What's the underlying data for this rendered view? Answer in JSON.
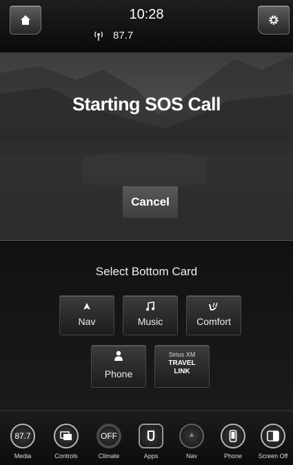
{
  "status_bar": {
    "time": "10:28",
    "radio_frequency": "87.7"
  },
  "sos": {
    "title": "Starting SOS Call",
    "cancel_label": "Cancel"
  },
  "card_selector": {
    "title": "Select Bottom Card",
    "cards": [
      {
        "label": "Nav",
        "icon": "nav-arrow-icon"
      },
      {
        "label": "Music",
        "icon": "music-note-icon"
      },
      {
        "label": "Comfort",
        "icon": "seat-heat-icon"
      },
      {
        "label": "Phone",
        "icon": "person-icon"
      }
    ],
    "siriusxm": {
      "brand": "Sirius XM",
      "line1": "TRAVEL",
      "line2": "LINK"
    }
  },
  "dock": {
    "items": [
      {
        "label": "Media",
        "value": "87.7"
      },
      {
        "label": "Controls",
        "icon": "controls-icon"
      },
      {
        "label": "Climate",
        "value": "OFF"
      },
      {
        "label": "Apps",
        "icon": "apps-icon"
      },
      {
        "label": "Nav",
        "icon": "compass-icon"
      },
      {
        "label": "Phone",
        "icon": "phone-icon"
      },
      {
        "label": "Screen Off",
        "icon": "screen-off-icon"
      }
    ]
  }
}
